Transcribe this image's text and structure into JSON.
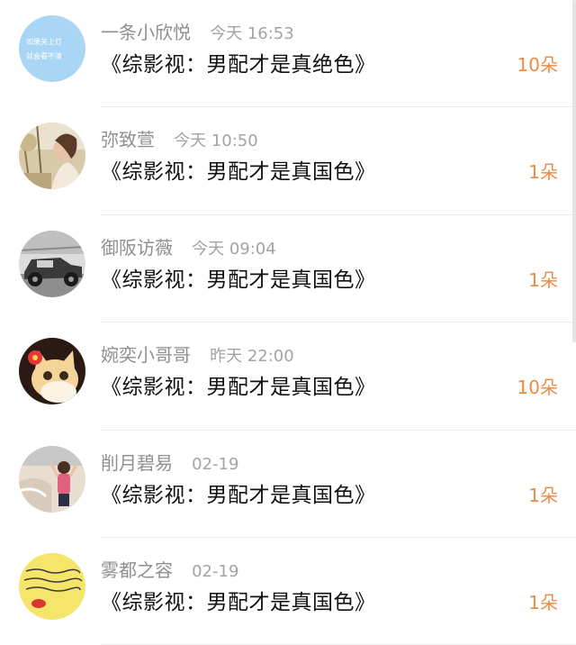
{
  "gift_list": [
    {
      "username": "一条小欣悦",
      "time": "今天 16:53",
      "message": "《综影视：男配才是真绝色》",
      "count": "10朵",
      "avatar": "avatar-light-blue-text",
      "avatar_lines": [
        "如果关上灯",
        "就会看不清"
      ]
    },
    {
      "username": "弥致萱",
      "time": "今天 10:50",
      "message": "《综影视：男配才是真国色》",
      "count": "1朵",
      "avatar": "avatar-woman-outdoors"
    },
    {
      "username": "御阪访薇",
      "time": "今天 09:04",
      "message": "《综影视：男配才是真国色》",
      "count": "1朵",
      "avatar": "avatar-vintage-car"
    },
    {
      "username": "婉奕小哥哥",
      "time": "昨天 22:00",
      "message": "《综影视：男配才是真国色》",
      "count": "10朵",
      "avatar": "avatar-cat-with-flower"
    },
    {
      "username": "削月碧易",
      "time": "02-19",
      "message": "《综影视：男配才是真国色》",
      "count": "1朵",
      "avatar": "avatar-girl-at-beach"
    },
    {
      "username": "雾都之容",
      "time": "02-19",
      "message": "《综影视：男配才是真国色》",
      "count": "1朵",
      "avatar": "avatar-yellow-handwriting"
    }
  ],
  "colors": {
    "count": "#ee8a43",
    "username": "#8f8f8f",
    "time": "#a3a3a3",
    "message": "#111111",
    "divider": "#eeeeee"
  }
}
